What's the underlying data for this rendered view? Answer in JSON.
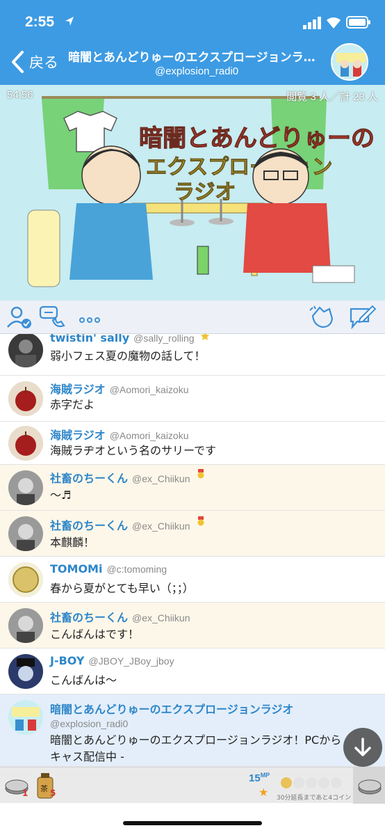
{
  "status_bar": {
    "time": "2:55"
  },
  "nav": {
    "back_label": "戻る",
    "title": "暗闇とあんどりゅーのエクスプロージョンラ…",
    "handle": "@explosion_radi0"
  },
  "video": {
    "elapsed": "54:56",
    "viewers": "閲覧 3 人／計 23 人",
    "title_art": "暗闇とあんどりゅーのエクスプロージョンラジオ"
  },
  "toolbar": {
    "icons": [
      "follow-check-icon",
      "call-icon",
      "more-icon",
      "applause-icon",
      "compose-icon"
    ]
  },
  "comments": [
    {
      "name": "twistin' sally",
      "handle": "@sally_rolling",
      "text": "弱小フェス夏の魔物の話して！",
      "style": "normal",
      "badge": "star"
    },
    {
      "name": "海賊ラジオ",
      "handle": "@Aomori_kaizoku",
      "text": "赤字だよ",
      "style": "normal"
    },
    {
      "name": "海賊ラジオ",
      "handle": "@Aomori_kaizoku",
      "text": "海賊ラヂオという名のサリーです",
      "style": "normal"
    },
    {
      "name": "社畜のちーくん",
      "handle": "@ex_Chiikun",
      "text": "〜♬",
      "style": "highlight",
      "badge": "medal"
    },
    {
      "name": "社畜のちーくん",
      "handle": "@ex_Chiikun",
      "text": "本麒麟！",
      "style": "highlight",
      "badge": "medal"
    },
    {
      "name": "TOMOMi",
      "handle": "@c:tomoming",
      "text": "春から夏がとても早い（；；）",
      "style": "normal"
    },
    {
      "name": "社畜のちーくん",
      "handle": "@ex_Chiikun",
      "text": "こんばんはです！",
      "style": "highlight"
    },
    {
      "name": "J-BOY",
      "handle": "@JBOY_JBoy_jboy",
      "text": "こんばんは〜",
      "style": "normal"
    },
    {
      "name": "暗闇とあんどりゅーのエクスプロージョンラジオ",
      "handle": "@explosion_radi0",
      "text_line1": "暗闇とあんどりゅーのエクスプロージョンラジオ！PCから",
      "text_line2": "キャス配信中 -",
      "style": "own"
    }
  ],
  "bottom_bar": {
    "item1_count": "1",
    "item2_count": "5",
    "item2_label": "茶",
    "mp_value": "15",
    "mp_unit": "MP",
    "extension_text": "30分延長まであと4コイン",
    "coins_filled": 1,
    "coins_total": 5
  },
  "colors": {
    "header": "#3d9be3",
    "name": "#2e86c9",
    "highlight_row": "#fdf7e9",
    "own_row": "#e3eefa"
  }
}
